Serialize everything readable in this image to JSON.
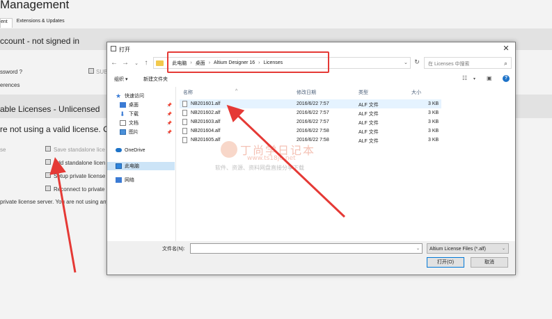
{
  "bg": {
    "title": "Management",
    "tabs": [
      "ent",
      "Extensions & Updates"
    ],
    "account_header": "ccount - not signed in",
    "password_label": "ssword ?",
    "preferences_label": "erences",
    "sub_label": "SUB",
    "licenses_header": "able Licenses - Unlicensed",
    "notice": "re not using a valid license. Click",
    "actions": {
      "use": "se",
      "save_standalone": "Save standalone lice",
      "add_standalone": "Add standalone licen",
      "setup_private": "Setup private license",
      "reconnect_private": "Reconnect to private"
    },
    "private_notice": "private license server. You are not using any lic"
  },
  "dialog": {
    "title": "打开",
    "breadcrumbs": [
      "此电脑",
      "桌面",
      "Altium Designer 16",
      "Licenses"
    ],
    "search_placeholder": "在 Licenses 中搜索",
    "toolbar": {
      "organize": "组织 ▾",
      "new_folder": "新建文件夹"
    },
    "nav": [
      {
        "label": "快速访问",
        "icon": "star-icon",
        "pinned": false
      },
      {
        "label": "桌面",
        "icon": "desktop-icon",
        "pinned": true
      },
      {
        "label": "下载",
        "icon": "download-icon",
        "pinned": true
      },
      {
        "label": "文档",
        "icon": "document-icon",
        "pinned": true
      },
      {
        "label": "图片",
        "icon": "picture-icon",
        "pinned": true
      },
      {
        "label": "OneDrive",
        "icon": "cloud-icon",
        "pinned": false
      },
      {
        "label": "此电脑",
        "icon": "computer-icon",
        "pinned": false
      },
      {
        "label": "网络",
        "icon": "network-icon",
        "pinned": false
      }
    ],
    "columns": {
      "name": "名称",
      "modified": "修改日期",
      "type": "类型",
      "size": "大小"
    },
    "files": [
      {
        "name": "NB201601.alf",
        "modified": "2016/6/22 7:57",
        "type": "ALF 文件",
        "size": "3 KB"
      },
      {
        "name": "NB201602.alf",
        "modified": "2016/6/22 7:57",
        "type": "ALF 文件",
        "size": "3 KB"
      },
      {
        "name": "NB201603.alf",
        "modified": "2016/6/22 7:57",
        "type": "ALF 文件",
        "size": "3 KB"
      },
      {
        "name": "NB201604.alf",
        "modified": "2016/6/22 7:58",
        "type": "ALF 文件",
        "size": "3 KB"
      },
      {
        "name": "NB201605.alf",
        "modified": "2016/6/22 7:58",
        "type": "ALF 文件",
        "size": "3 KB"
      }
    ],
    "filename_label": "文件名(N):",
    "filename_value": "",
    "filetype": "Altium License Files (*.alf)",
    "open_button": "打开(O)",
    "cancel_button": "取消"
  },
  "watermark": {
    "name": "丁尚学日记本",
    "url": "www.ts18j6.net",
    "slogan": "软件、资源、资料网盘直接分享下载"
  },
  "colors": {
    "highlight": "#e53935",
    "selection": "#cce4f7",
    "accent": "#0078d7"
  }
}
